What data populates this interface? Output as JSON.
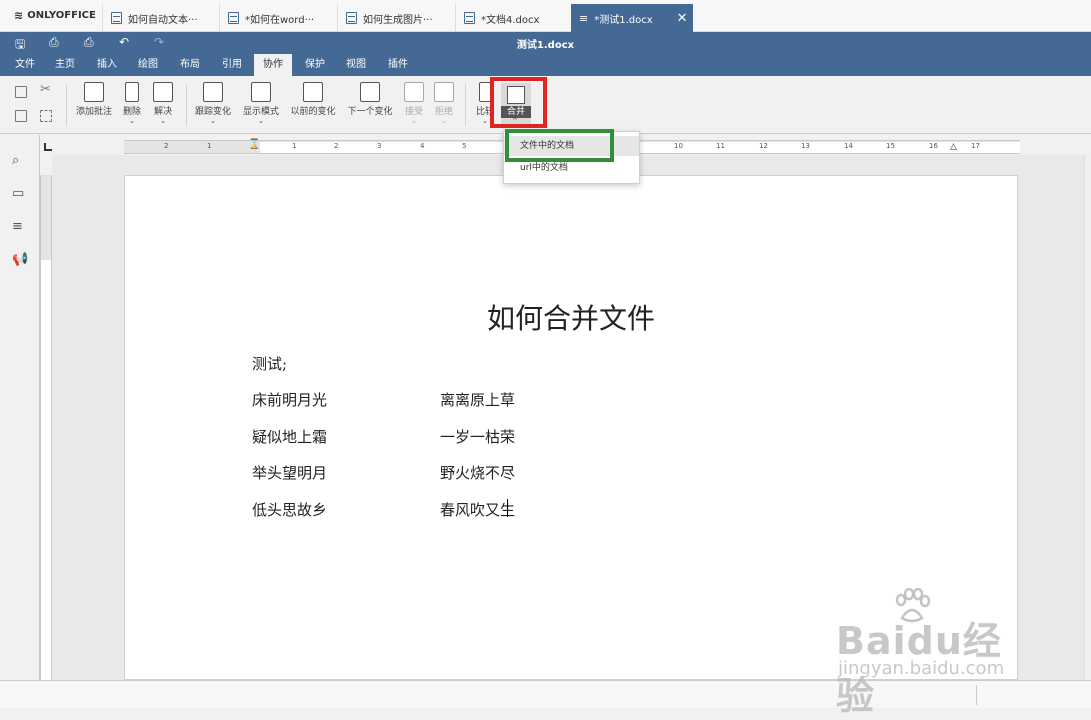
{
  "app": {
    "name": "ONLYOFFICE"
  },
  "tabs": [
    {
      "label": "如何自动文本···"
    },
    {
      "label": "*如何在word···"
    },
    {
      "label": "如何生成图片···"
    },
    {
      "label": "*文档4.docx"
    },
    {
      "label": "*测试1.docx",
      "active": true
    }
  ],
  "window": {
    "title": "测试1.docx"
  },
  "menu": [
    "文件",
    "主页",
    "插入",
    "绘图",
    "布局",
    "引用",
    "协作",
    "保护",
    "视图",
    "插件"
  ],
  "toolbar": {
    "add_comment": "添加批注",
    "delete": "删除",
    "resolve": "解决",
    "track_changes": "跟踪变化",
    "display_mode": "显示模式",
    "prev_change": "以前的变化",
    "next_change": "下一个变化",
    "accept": "接受",
    "reject": "拒绝",
    "compare": "比较",
    "merge": "合并"
  },
  "merge_menu": [
    "文件中的文档",
    "url中的文档"
  ],
  "ruler": {
    "numbers": [
      "2",
      "1",
      "1",
      "2",
      "3",
      "4",
      "5",
      "10",
      "11",
      "12",
      "13",
      "14",
      "15",
      "16",
      "17"
    ]
  },
  "document": {
    "title": "如何合并文件",
    "intro": "测试;",
    "lines": [
      [
        "床前明月光",
        "离离原上草"
      ],
      [
        "疑似地上霜",
        "一岁一枯荣"
      ],
      [
        "举头望明月",
        "野火烧不尽"
      ],
      [
        "低头思故乡",
        "春风吹又生"
      ]
    ]
  },
  "watermark": {
    "brand": "Baidu经验",
    "site": "jingyan.baidu.com"
  },
  "colors": {
    "accent": "#446995",
    "highlight_red": "#e02424",
    "highlight_green": "#2f8f3a"
  }
}
